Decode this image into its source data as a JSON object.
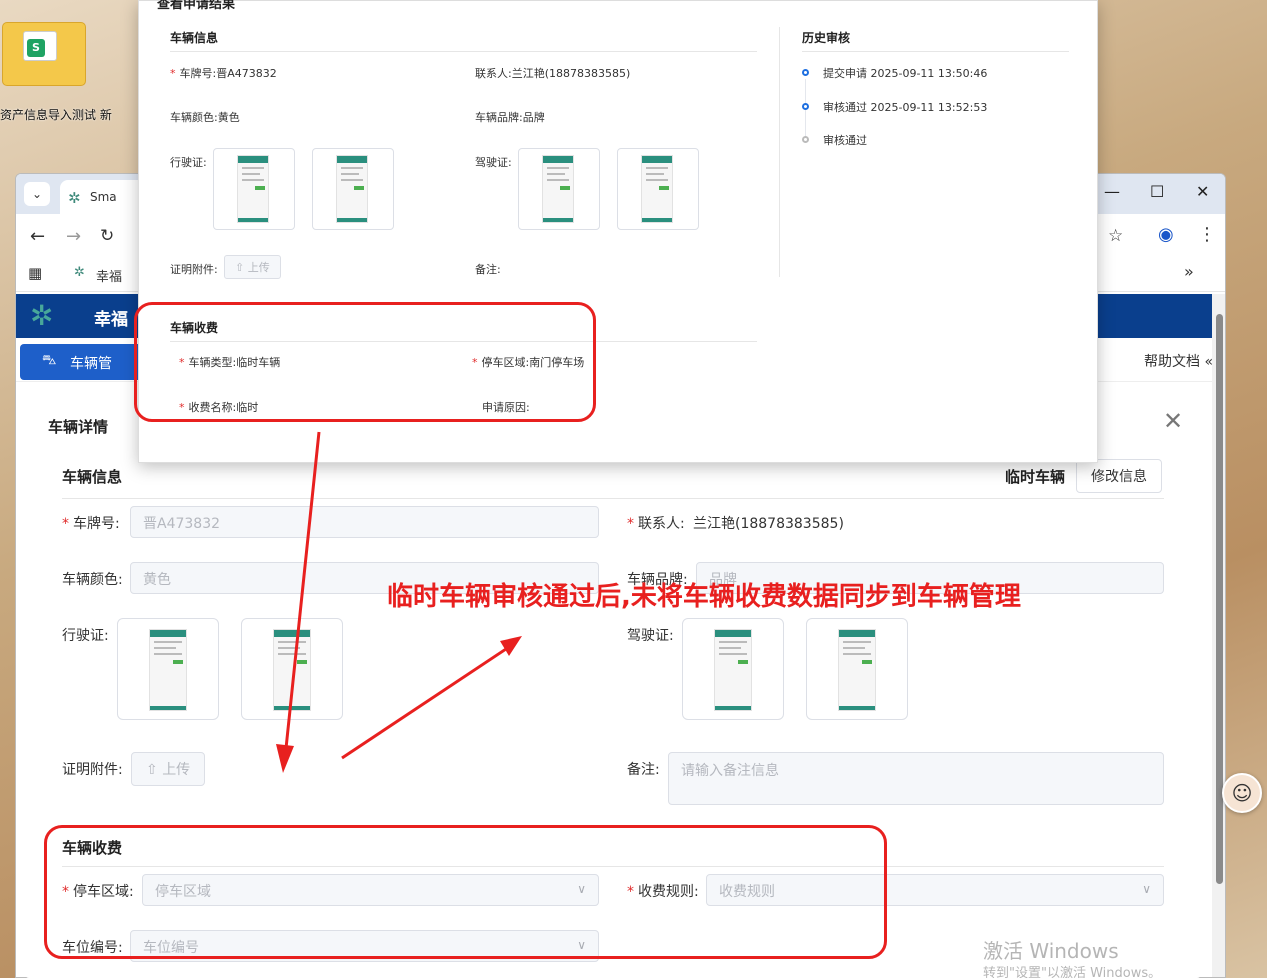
{
  "desktop": {
    "icon_label": "资产信息导入测试 新"
  },
  "browser": {
    "tab_title": "Sma",
    "bookmark_label": "幸福",
    "more_label": "»",
    "app_title": "幸福",
    "nav_active": "车辆管",
    "help_label": "帮助文档"
  },
  "detail": {
    "title": "车辆详情",
    "vehicle_info": {
      "section_title": "车辆信息",
      "vehicle_type_tag": "临时车辆",
      "edit_button": "修改信息",
      "plate_label": "车牌号:",
      "plate_value": "晋A473832",
      "contact_label": "联系人:",
      "contact_value": "兰江艳(18878383585)",
      "color_label": "车辆颜色:",
      "color_value": "黄色",
      "brand_label": "车辆品牌:",
      "brand_value": "品牌",
      "license_label": "行驶证:",
      "driver_label": "驾驶证:",
      "attachment_label": "证明附件:",
      "upload_label": "上传",
      "remark_label": "备注:",
      "remark_placeholder": "请输入备注信息"
    },
    "fee": {
      "section_title": "车辆收费",
      "area_label": "停车区域:",
      "area_placeholder": "停车区域",
      "rule_label": "收费规则:",
      "rule_placeholder": "收费规则",
      "space_label": "车位编号:",
      "space_placeholder": "车位编号"
    }
  },
  "review": {
    "title": "查看申请结果",
    "vehicle_info": {
      "section_title": "车辆信息",
      "plate": "车牌号:晋A473832",
      "contact": "联系人:兰江艳(18878383585)",
      "color": "车辆颜色:黄色",
      "brand": "车辆品牌:品牌",
      "license_label": "行驶证:",
      "driver_label": "驾驶证:",
      "attachment_label": "证明附件:",
      "upload_label": "上传",
      "remark_label": "备注:"
    },
    "fee": {
      "section_title": "车辆收费",
      "vehicle_type": "车辆类型:临时车辆",
      "area": "停车区域:南门停车场",
      "fee_name": "收费名称:临时",
      "reason": "申请原因:"
    },
    "history": {
      "section_title": "历史审核",
      "items": [
        {
          "text": "提交申请 2025-09-11 13:50:46"
        },
        {
          "text": "审核通过 2025-09-11 13:52:53"
        },
        {
          "text": "审核通过"
        }
      ]
    }
  },
  "annotation": "临时车辆审核通过后,未将车辆收费数据同步到车辆管理",
  "watermark": {
    "line1": "激活 Windows",
    "line2": "转到\"设置\"以激活 Windows。"
  },
  "colors": {
    "accent": "#1e5fc9",
    "header": "#0a3f8d",
    "annotation": "#e8201f",
    "required": "#e02b2b"
  }
}
